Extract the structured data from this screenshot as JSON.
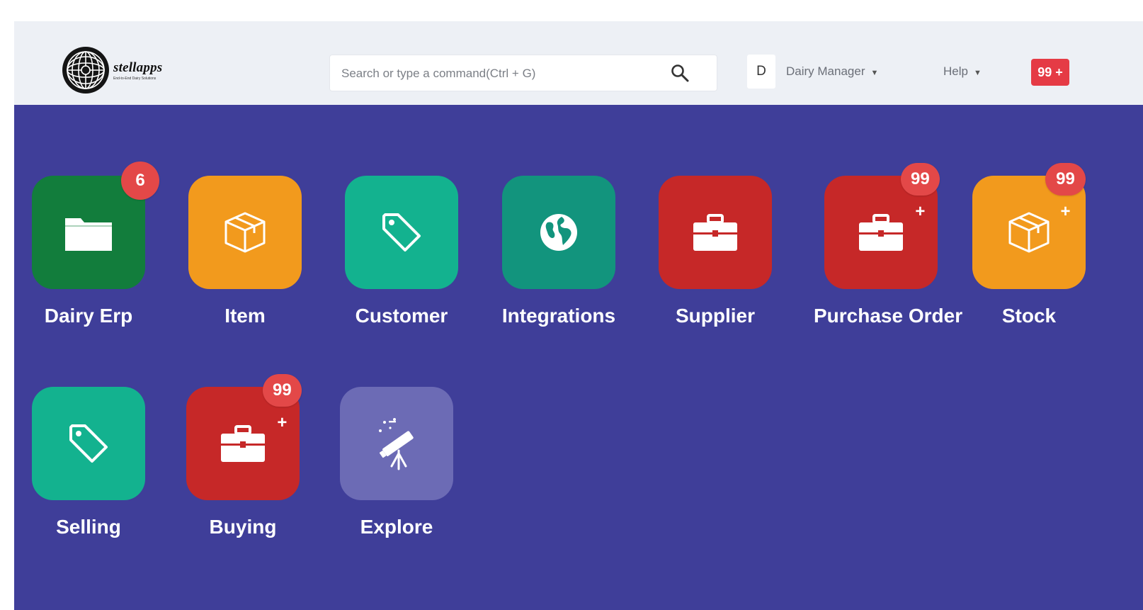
{
  "app": {
    "logo_name": "stellapps",
    "logo_tagline": "End-to-End Dairy Solutions"
  },
  "navbar": {
    "search_placeholder": "Search or type a command(Ctrl + G)",
    "avatar_initial": "D",
    "user_menu_label": "Dairy Manager",
    "help_label": "Help",
    "notifications_count": "99 +",
    "dropdown_caret": "▼"
  },
  "colors": {
    "background": "#3f3e99",
    "navbar": "#edf0f5",
    "badge": "#e34848",
    "dark_green": "#127d3c",
    "orange": "#f29a1d",
    "teal": "#13b28f",
    "dark_teal": "#12947d",
    "red": "#c62828",
    "lavender": "#6c6bb5"
  },
  "modules": [
    {
      "label": "Dairy Erp",
      "badge": "6",
      "icon": "folder-icon",
      "color": "#127d3c"
    },
    {
      "label": "Item",
      "badge": "",
      "icon": "box-icon",
      "color": "#f29a1d"
    },
    {
      "label": "Customer",
      "badge": "",
      "icon": "tag-icon",
      "color": "#13b28f"
    },
    {
      "label": "Integrations",
      "badge": "",
      "icon": "globe-icon",
      "color": "#12947d"
    },
    {
      "label": "Supplier",
      "badge": "",
      "icon": "briefcase-icon",
      "color": "#c62828"
    },
    {
      "label": "Purchase Order",
      "badge": "99 +",
      "icon": "briefcase-icon",
      "color": "#c62828"
    },
    {
      "label": "Stock",
      "badge": "99 +",
      "icon": "box-icon",
      "color": "#f29a1d"
    },
    {
      "label": "Selling",
      "badge": "",
      "icon": "tag-icon",
      "color": "#13b28f"
    },
    {
      "label": "Buying",
      "badge": "99 +",
      "icon": "briefcase-icon",
      "color": "#c62828"
    },
    {
      "label": "Explore",
      "badge": "",
      "icon": "telescope-icon",
      "color": "#6c6bb5"
    }
  ]
}
